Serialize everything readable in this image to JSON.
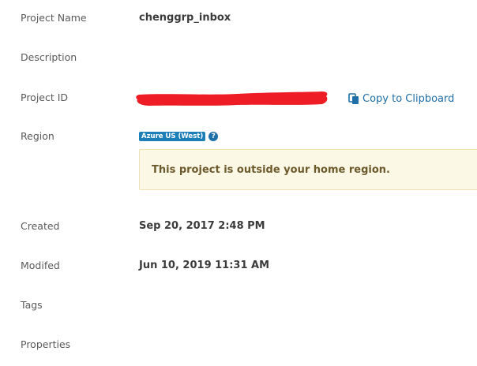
{
  "fields": {
    "project_name": {
      "label": "Project Name",
      "value": "chenggrp_inbox"
    },
    "description": {
      "label": "Description",
      "value": ""
    },
    "project_id": {
      "label": "Project ID",
      "copy_label": "Copy to Clipboard",
      "redaction_color": "#ee1c24"
    },
    "region": {
      "label": "Region",
      "badge": "Azure US (West)",
      "help_glyph": "?",
      "notice": "This project is outside your home region."
    },
    "created": {
      "label": "Created",
      "value": "Sep 20, 2017 2:48 PM"
    },
    "modified": {
      "label": "Modifed",
      "value": "Jun 10, 2019 11:31 AM"
    },
    "tags": {
      "label": "Tags"
    },
    "properties": {
      "label": "Properties"
    }
  },
  "icons": {
    "copy": "clipboard-icon",
    "help": "question-circle-icon"
  },
  "colors": {
    "link": "#1f6fa8",
    "badge": "#1d7fb7",
    "notice_bg": "#fcf8e6",
    "notice_text": "#6d5a2c"
  }
}
